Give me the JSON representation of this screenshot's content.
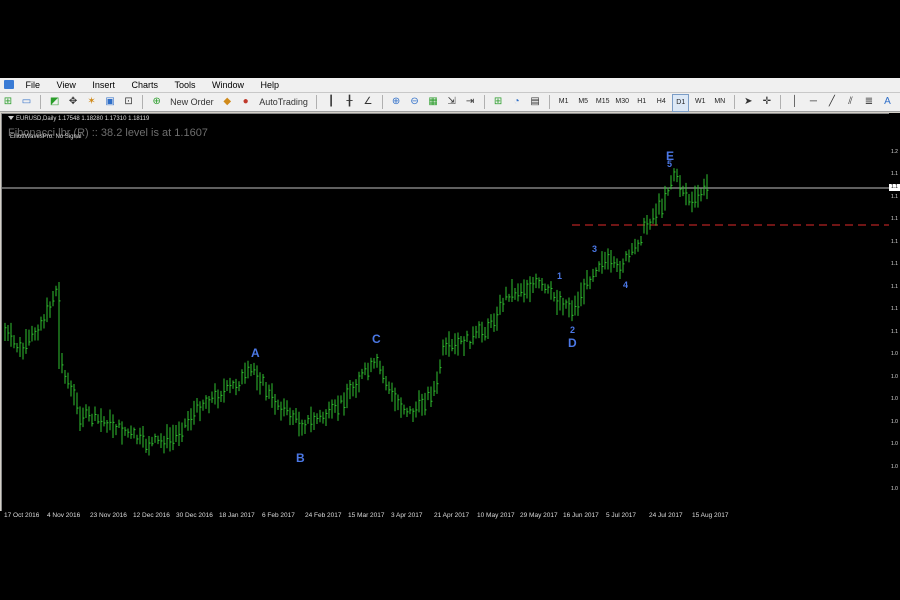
{
  "menu": [
    "File",
    "View",
    "Insert",
    "Charts",
    "Tools",
    "Window",
    "Help"
  ],
  "toolbar": {
    "new_order_label": "New Order",
    "autotrading_label": "AutoTrading",
    "timeframes": [
      "M1",
      "M5",
      "M15",
      "M30",
      "H1",
      "H4",
      "D1",
      "W1",
      "MN"
    ],
    "active_timeframe": "D1"
  },
  "chart": {
    "header": "EURUSD,Daily  1.17548 1.18280 1.17310 1.18119",
    "fib_text": "Fibonacci lbr (R) :: 38.2 level is at 1.1607",
    "indicator_status": "ElliottWavesPro: No Signal",
    "colors": {
      "bars": "#2fbf2f",
      "wave_labels": "#4b78e6",
      "fib_line": "#b22222",
      "price_line": "#c0c0c0"
    },
    "wave_labels": [
      "A",
      "B",
      "C",
      "D",
      "E"
    ],
    "wave_numbers": [
      "1",
      "2",
      "3",
      "4",
      "5"
    ],
    "time_labels": [
      "17 Oct 2016",
      "4 Nov 2016",
      "23 Nov 2016",
      "12 Dec 2016",
      "30 Dec 2016",
      "18 Jan 2017",
      "6 Feb 2017",
      "24 Feb 2017",
      "15 Mar 2017",
      "3 Apr 2017",
      "21 Apr 2017",
      "10 May 2017",
      "29 May 2017",
      "16 Jun 2017",
      "5 Jul 2017",
      "24 Jul 2017",
      "15 Aug 2017"
    ],
    "price_labels": [
      "1.2",
      "1.1",
      "1.1",
      "1.1",
      "1.1",
      "1.1",
      "1.1",
      "1.1",
      "1.1",
      "1.0",
      "1.0",
      "1.0",
      "1.0",
      "1.0",
      "1.0",
      "1.0"
    ],
    "current_price_label": "1.1"
  }
}
